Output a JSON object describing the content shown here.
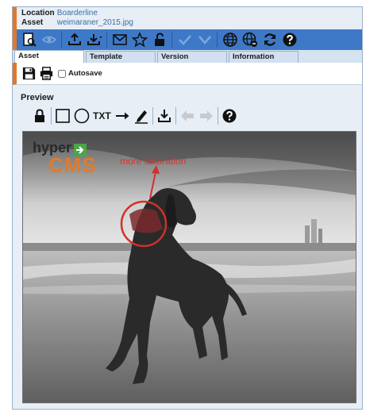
{
  "info": {
    "location_label": "Location",
    "location_value": "Boarderline",
    "asset_label": "Asset",
    "asset_value": "weimaraner_2015.jpg"
  },
  "tabs": [
    {
      "label": "Asset"
    },
    {
      "label": "Template"
    },
    {
      "label": "Version"
    },
    {
      "label": "Information"
    }
  ],
  "subbar": {
    "autosave_label": "Autosave"
  },
  "preview": {
    "title": "Preview",
    "txt_tool": "TXT",
    "logo_hyper": "hyper",
    "logo_cms": "CMS",
    "annotation": "more saturation"
  },
  "colors": {
    "toolbar": "#3e79c7",
    "accent": "#e2772b",
    "annotation": "#e0322b",
    "background": "#e7eef6"
  }
}
